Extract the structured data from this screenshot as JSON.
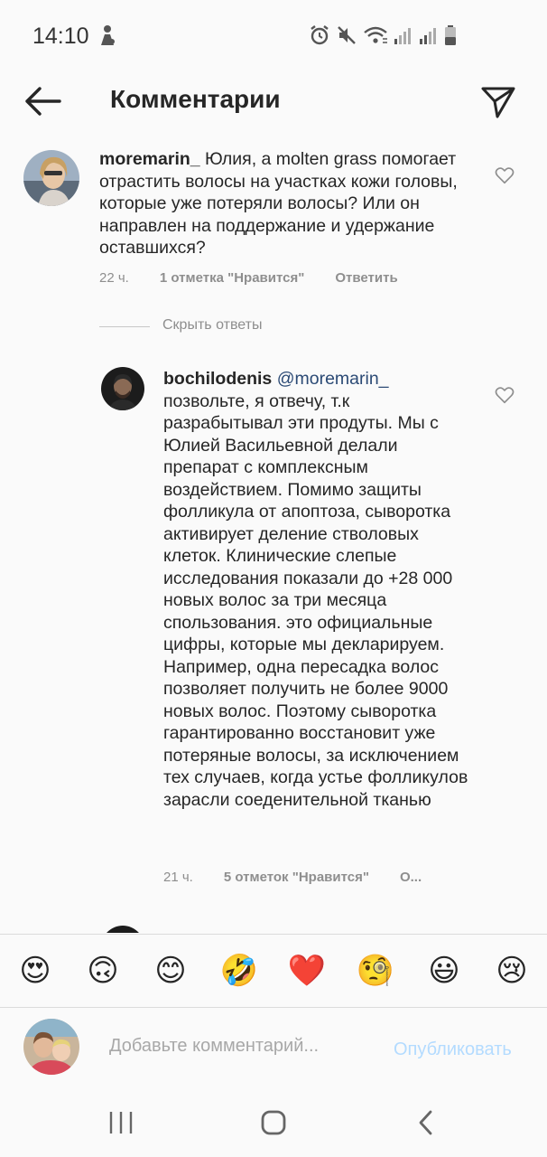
{
  "status": {
    "time": "14:10"
  },
  "header": {
    "title": "Комментарии"
  },
  "comments": [
    {
      "username": "moremarin_",
      "text": " Юлия, а molten grass помогает отрастить волосы на участках кожи головы, которые уже потеряли волосы? Или он направлен на поддержание и удержание оставшихся?",
      "time": "22 ч.",
      "likes": "1 отметка \"Нравится\"",
      "reply": "Ответить"
    }
  ],
  "replies_toggle": "Скрыть ответы",
  "replies": [
    {
      "username": "bochilodenis",
      "mention": "@moremarin_",
      "text": "позвольте, я отвечу, т.к разрабытывал эти продуты. Мы с Юлией Васильевной делали препарат с комплексным воздействием. Помимо защиты фолликула от апоптоза, сыворотка активирует деление стволовых клеток. Клинические слепые исследования показали до +28 000 новых волос за три месяца спользования. это официальные цифры, которые мы декларируем. Например, одна пересадка волос позволяет получить не более 9000 новых волос. Поэтому сыворотка гарантированно восстановит уже потеряные волосы, за исключением тех случаев, когда устье фолликулов зарасли соеденительной тканью",
      "time": "21 ч.",
      "likes": "5 отметок \"Нравится\"",
      "reply": "О..."
    }
  ],
  "emoji_bar": [
    "😍",
    "🙃",
    "😊",
    "🤣",
    "❤️",
    "🧐",
    "😃",
    "😢"
  ],
  "compose": {
    "placeholder": "Добавьте комментарий...",
    "publish": "Опубликовать"
  },
  "colors": {
    "mention": "#2b4a75",
    "publish_disabled": "#b3dbff",
    "meta": "#8e8e8e"
  }
}
